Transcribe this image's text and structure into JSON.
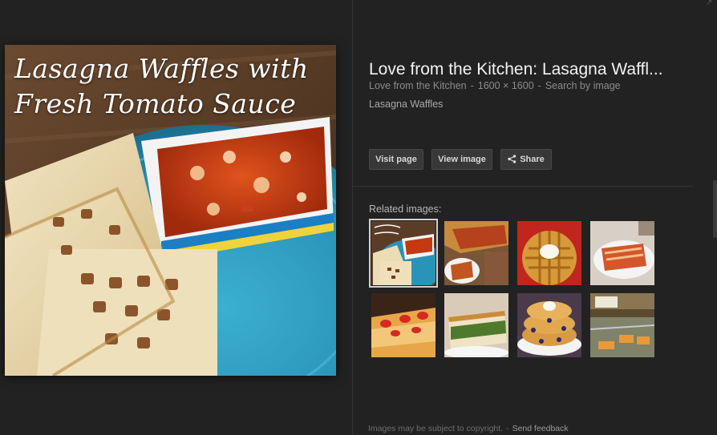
{
  "preview": {
    "overlay_line1": "Lasagna Waffles with",
    "overlay_line2": "Fresh Tomato Sauce"
  },
  "info": {
    "title": "Love from the Kitchen: Lasagna Waffl...",
    "source": "Love from the Kitchen",
    "dimensions": "1600 × 1600",
    "search_by_image": "Search by image",
    "separator": "-",
    "subtitle": "Lasagna Waffles"
  },
  "buttons": {
    "visit": "Visit page",
    "view": "View image",
    "share": "Share",
    "share_icon": "share-icon"
  },
  "related": {
    "label": "Related images:",
    "items": [
      {
        "name": "lasagna-waffles-thumb",
        "selected": true
      },
      {
        "name": "lasagna-slice-thumb",
        "selected": false
      },
      {
        "name": "waffle-cream-thumb",
        "selected": false
      },
      {
        "name": "lasagna-plate-thumb",
        "selected": false
      },
      {
        "name": "strawberry-cake-thumb",
        "selected": false
      },
      {
        "name": "spinach-casserole-thumb",
        "selected": false
      },
      {
        "name": "blueberry-waffles-thumb",
        "selected": false
      },
      {
        "name": "bakery-counter-thumb",
        "selected": false
      }
    ]
  },
  "footer": {
    "copyright": "Images may be subject to copyright.",
    "separator": "-",
    "feedback": "Send feedback"
  },
  "colors": {
    "background": "#222222",
    "button_bg": "#383838",
    "text_primary": "#f2f2f2",
    "text_muted": "#8c8c8c"
  }
}
